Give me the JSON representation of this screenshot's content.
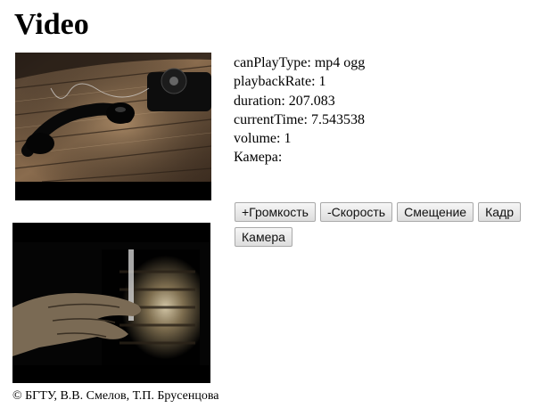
{
  "page": {
    "title": "Video"
  },
  "video_info": {
    "can_play_type": "canPlayType: mp4 ogg",
    "playback_rate": "playbackRate: 1",
    "duration": "duration: 207.083",
    "current_time": "currentTime: 7.543538",
    "volume": "volume: 1",
    "camera": "Камера:"
  },
  "buttons": {
    "volume_up": "+Громкость",
    "speed_down": "-Скорость",
    "offset": "Смещение",
    "frame": "Кадр",
    "camera": "Камера"
  },
  "footer": {
    "copyright": "© БГТУ, В.В. Смелов, Т.П. Брусенцова"
  }
}
